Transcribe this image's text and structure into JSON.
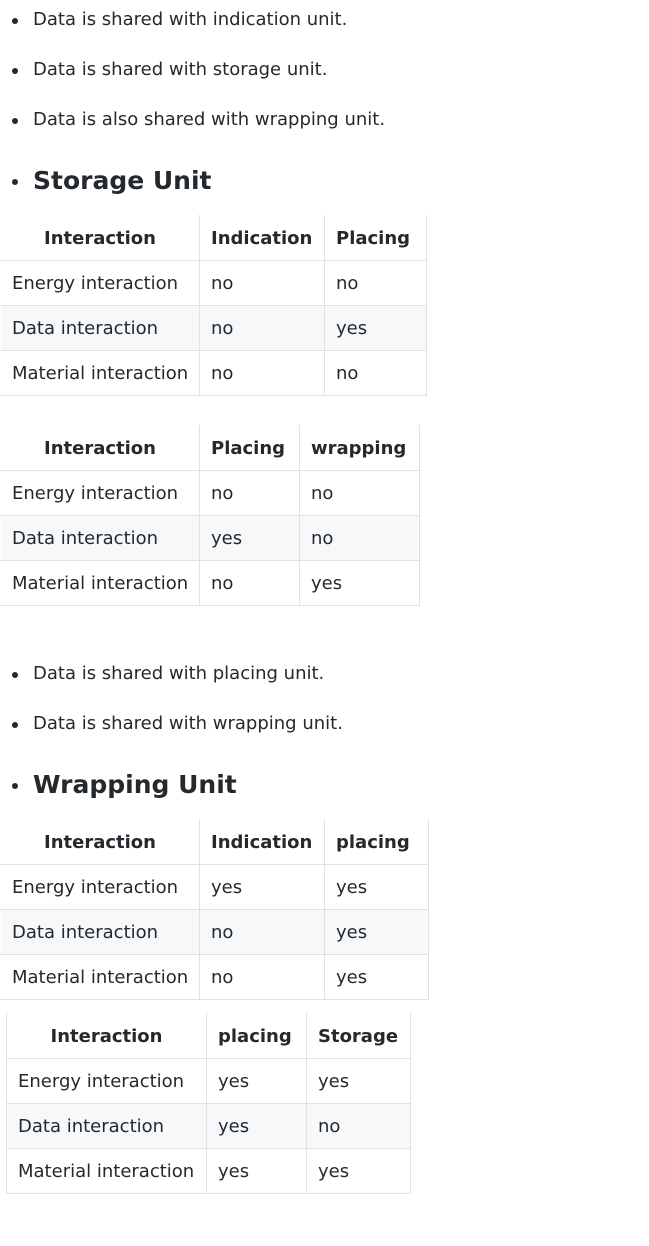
{
  "intro_bullets": [
    "Data is shared with indication unit.",
    "Data is shared with storage unit.",
    "Data is also shared with wrapping unit."
  ],
  "storage_heading": "Storage Unit",
  "table1": {
    "headers": [
      "Interaction",
      "Indication",
      "Placing"
    ],
    "rows": [
      [
        "Energy interaction",
        "no",
        "no"
      ],
      [
        "Data interaction",
        "no",
        "yes"
      ],
      [
        "Material interaction",
        "no",
        "no"
      ]
    ]
  },
  "table2": {
    "headers": [
      "Interaction",
      "Placing",
      "wrapping"
    ],
    "rows": [
      [
        "Energy interaction",
        "no",
        "no"
      ],
      [
        "Data interaction",
        "yes",
        "no"
      ],
      [
        "Material interaction",
        "no",
        "yes"
      ]
    ]
  },
  "storage_bullets": [
    "Data is shared with placing unit.",
    "Data is shared with wrapping unit."
  ],
  "wrapping_heading": "Wrapping Unit",
  "table3": {
    "headers": [
      "Interaction",
      "Indication",
      "placing"
    ],
    "rows": [
      [
        "Energy interaction",
        "yes",
        "yes"
      ],
      [
        "Data interaction",
        "no",
        "yes"
      ],
      [
        "Material interaction",
        "no",
        "yes"
      ]
    ]
  },
  "table4": {
    "headers": [
      "Interaction",
      "placing",
      "Storage"
    ],
    "rows": [
      [
        "Energy interaction",
        "yes",
        "yes"
      ],
      [
        "Data interaction",
        "yes",
        "no"
      ],
      [
        "Material interaction",
        "yes",
        "yes"
      ]
    ]
  }
}
